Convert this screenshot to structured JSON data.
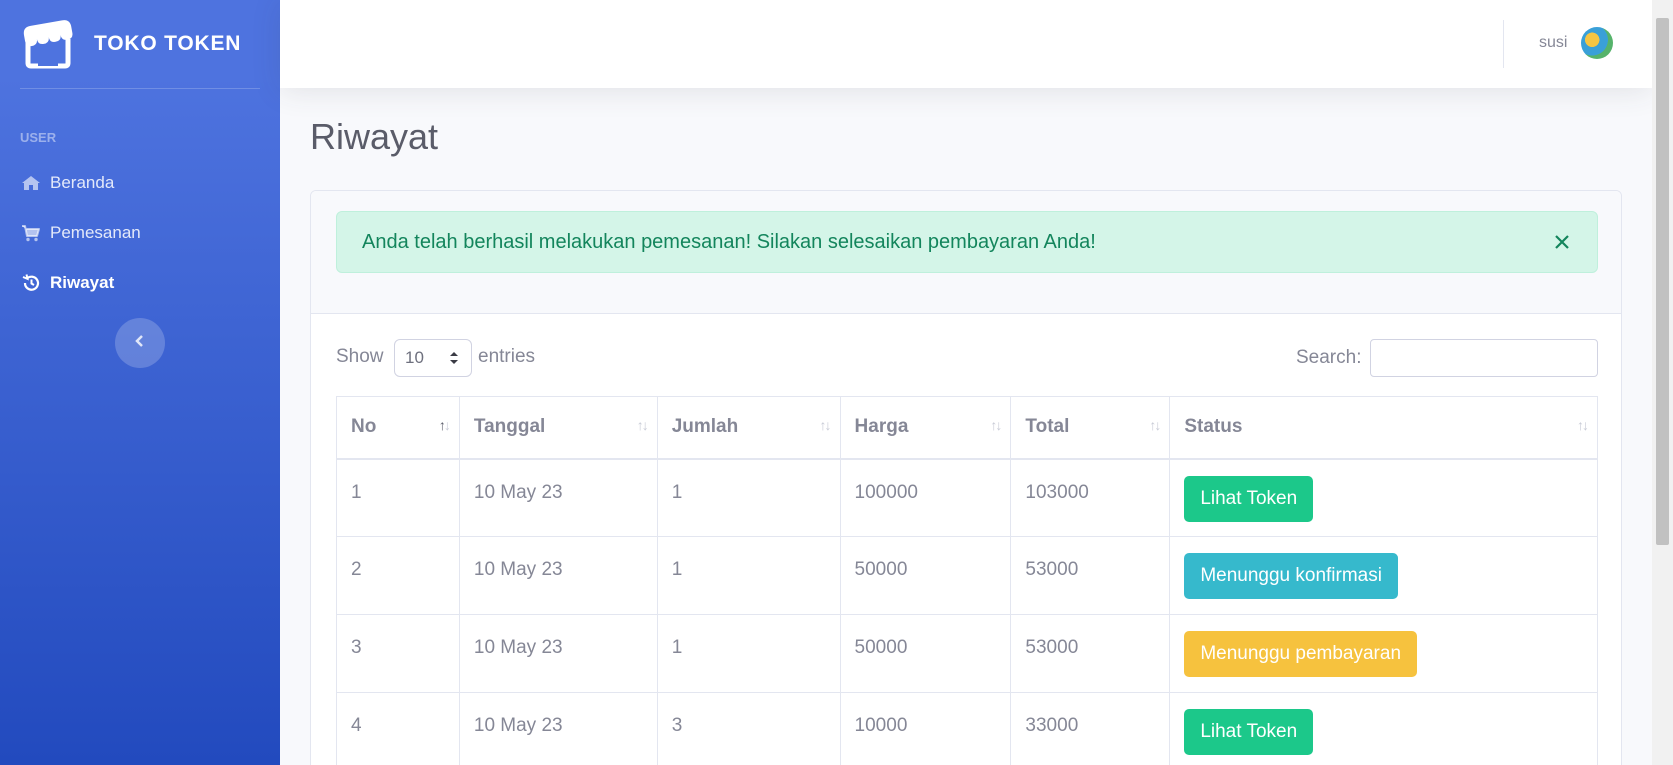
{
  "brand": {
    "name": "TOKO TOKEN",
    "logo_icon": "store-icon"
  },
  "sidebar": {
    "heading": "USER",
    "items": [
      {
        "label": "Beranda",
        "icon": "home-icon",
        "active": false
      },
      {
        "label": "Pemesanan",
        "icon": "shopping-cart-icon",
        "active": false
      },
      {
        "label": "Riwayat",
        "icon": "history-icon",
        "active": true
      }
    ],
    "toggle_icon": "chevron-left-icon"
  },
  "topbar": {
    "username": "susi",
    "avatar_icon": "avatar-icon"
  },
  "page": {
    "title": "Riwayat"
  },
  "alert": {
    "message": "Anda telah berhasil melakukan pemesanan! Silakan selesaikan pembayaran Anda!",
    "close_icon": "close-icon"
  },
  "table_controls": {
    "show_label": "Show",
    "entries_value": "10",
    "entries_label": "entries",
    "search_label": "Search:",
    "search_value": ""
  },
  "table": {
    "columns": [
      "No",
      "Tanggal",
      "Jumlah",
      "Harga",
      "Total",
      "Status"
    ],
    "rows": [
      {
        "no": "1",
        "tanggal": "10 May 23",
        "jumlah": "1",
        "harga": "100000",
        "total": "103000",
        "status": "Lihat Token",
        "status_color": "#1cc88a"
      },
      {
        "no": "2",
        "tanggal": "10 May 23",
        "jumlah": "1",
        "harga": "50000",
        "total": "53000",
        "status": "Menunggu konfirmasi",
        "status_color": "#36b9cc"
      },
      {
        "no": "3",
        "tanggal": "10 May 23",
        "jumlah": "1",
        "harga": "50000",
        "total": "53000",
        "status": "Menunggu pembayaran",
        "status_color": "#f6c23e"
      },
      {
        "no": "4",
        "tanggal": "10 May 23",
        "jumlah": "3",
        "harga": "10000",
        "total": "33000",
        "status": "Lihat Token",
        "status_color": "#1cc88a"
      }
    ]
  },
  "colors": {
    "primary": "#4e73df",
    "success": "#1cc88a",
    "info": "#36b9cc",
    "warning": "#f6c23e"
  }
}
